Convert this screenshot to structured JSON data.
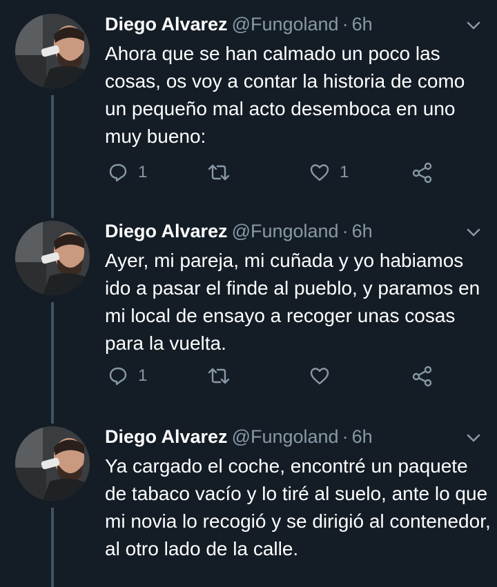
{
  "theme": {
    "background": "#141d26",
    "text_primary": "#ffffff",
    "text_secondary": "#8899a6",
    "thread_line": "#3d5466"
  },
  "tweets": [
    {
      "author_name": "Diego Alvarez",
      "handle": "@Fungoland",
      "separator": "·",
      "time": "6h",
      "text": "Ahora que se han calmado un poco las cosas, os voy a contar la historia de como un pequeño mal acto desemboca en uno muy bueno:",
      "actions": {
        "reply_icon": "reply-icon",
        "reply_count": "1",
        "retweet_icon": "retweet-icon",
        "retweet_count": "",
        "like_icon": "heart-icon",
        "like_count": "1",
        "share_icon": "share-icon"
      }
    },
    {
      "author_name": "Diego Alvarez",
      "handle": "@Fungoland",
      "separator": "·",
      "time": "6h",
      "text": "Ayer, mi pareja, mi cuñada y yo habiamos ido a pasar el finde al pueblo, y paramos en mi local de ensayo a recoger unas cosas para la vuelta.",
      "actions": {
        "reply_icon": "reply-icon",
        "reply_count": "1",
        "retweet_icon": "retweet-icon",
        "retweet_count": "",
        "like_icon": "heart-icon",
        "like_count": "",
        "share_icon": "share-icon"
      }
    },
    {
      "author_name": "Diego Alvarez",
      "handle": "@Fungoland",
      "separator": "·",
      "time": "6h",
      "text": "Ya cargado el coche, encontré un paquete de tabaco vacío y lo tiré al suelo, ante lo que mi novia lo recogió y se dirigió al contenedor, al otro lado de la calle.",
      "actions": null
    }
  ]
}
